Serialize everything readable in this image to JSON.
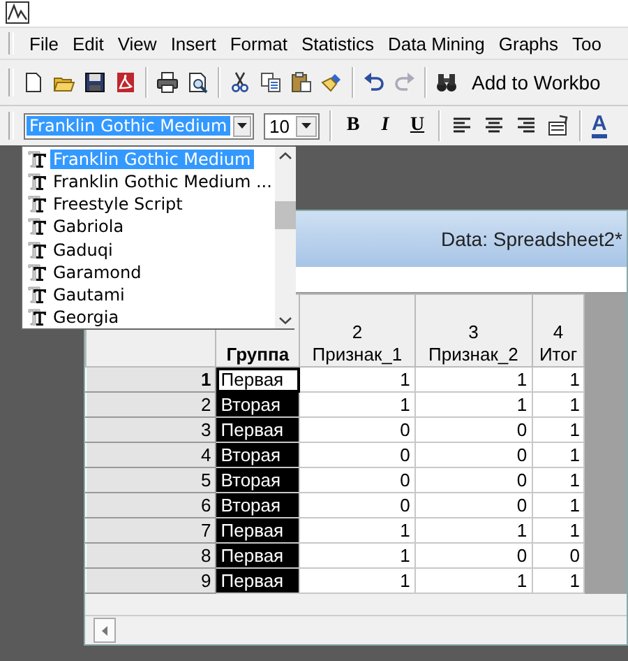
{
  "menu": [
    "File",
    "Edit",
    "View",
    "Insert",
    "Format",
    "Statistics",
    "Data Mining",
    "Graphs",
    "Too"
  ],
  "toolbar": {
    "groups": [
      {
        "icons": [
          {
            "kind": "new"
          },
          {
            "kind": "open"
          },
          {
            "kind": "save"
          },
          {
            "kind": "pdf"
          }
        ]
      },
      {
        "icons": [
          {
            "kind": "print"
          },
          {
            "kind": "preview"
          }
        ]
      },
      {
        "icons": [
          {
            "kind": "cut"
          },
          {
            "kind": "copy"
          },
          {
            "kind": "paste"
          },
          {
            "kind": "brush"
          }
        ]
      },
      {
        "icons": [
          {
            "kind": "undo"
          },
          {
            "kind": "redo"
          }
        ]
      },
      {
        "icons": [
          {
            "kind": "find"
          }
        ]
      }
    ],
    "label": "Add to Workbo"
  },
  "format_bar": {
    "font": "Franklin Gothic Medium",
    "size": "10",
    "buttons": [
      {
        "kind": "bold",
        "label": "B"
      },
      {
        "kind": "italic",
        "label": "I"
      },
      {
        "kind": "underline",
        "label": "U"
      }
    ],
    "icons": [
      {
        "kind": "align-left"
      },
      {
        "kind": "align-center"
      },
      {
        "kind": "align-right"
      },
      {
        "kind": "properties"
      }
    ],
    "color_label": "A"
  },
  "font_list": {
    "items": [
      {
        "label": "Franklin Gothic Medium",
        "selected": true
      },
      {
        "label": "Franklin Gothic Medium ...",
        "selected": false
      },
      {
        "label": "Freestyle Script",
        "selected": false
      },
      {
        "label": "Gabriola",
        "selected": false
      },
      {
        "label": "Gaduqi",
        "selected": false
      },
      {
        "label": "Garamond",
        "selected": false
      },
      {
        "label": "Gautami",
        "selected": false
      },
      {
        "label": "Georgia",
        "selected": false
      }
    ]
  },
  "sheet": {
    "title": "Data: Spreadsheet2*",
    "columns": [
      {
        "name": "Группа"
      },
      {
        "number": "2",
        "name": "Признак_1"
      },
      {
        "number": "3",
        "name": "Признак_2"
      },
      {
        "number": "4",
        "name": "Итог"
      }
    ],
    "rows": [
      {
        "n": "1",
        "group": "Первая",
        "active": true,
        "values": [
          "1",
          "1",
          "1"
        ]
      },
      {
        "n": "2",
        "group": "Вторая",
        "active": false,
        "values": [
          "1",
          "1",
          "1"
        ]
      },
      {
        "n": "3",
        "group": "Первая",
        "active": false,
        "values": [
          "0",
          "0",
          "1"
        ]
      },
      {
        "n": "4",
        "group": "Вторая",
        "active": false,
        "values": [
          "0",
          "0",
          "1"
        ]
      },
      {
        "n": "5",
        "group": "Вторая",
        "active": false,
        "values": [
          "0",
          "0",
          "1"
        ]
      },
      {
        "n": "6",
        "group": "Вторая",
        "active": false,
        "values": [
          "0",
          "0",
          "1"
        ]
      },
      {
        "n": "7",
        "group": "Первая",
        "active": false,
        "values": [
          "1",
          "1",
          "1"
        ]
      },
      {
        "n": "8",
        "group": "Первая",
        "active": false,
        "values": [
          "1",
          "0",
          "0"
        ]
      },
      {
        "n": "9",
        "group": "Первая",
        "active": false,
        "values": [
          "1",
          "1",
          "1"
        ]
      }
    ]
  }
}
